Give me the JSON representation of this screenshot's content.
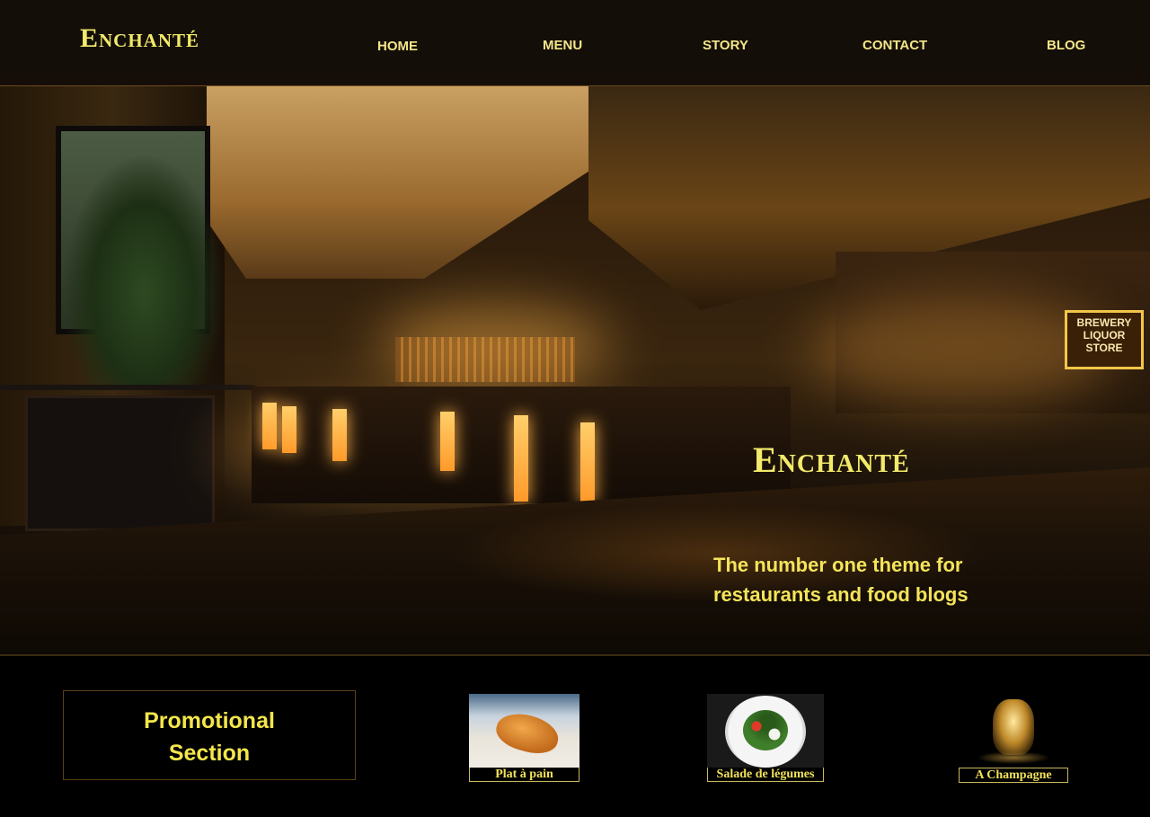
{
  "brand": {
    "logo": "Enchanté"
  },
  "nav": {
    "items": [
      {
        "label": "HOME"
      },
      {
        "label": "MENU"
      },
      {
        "label": "STORY"
      },
      {
        "label": "CONTACT"
      },
      {
        "label": "BLOG"
      }
    ]
  },
  "hero": {
    "title": "Enchanté",
    "subtitle_line1": "The number one theme for",
    "subtitle_line2": "restaurants and food blogs",
    "photo_sign": "BREWERY LIQUOR STORE"
  },
  "promo": {
    "line1": "Promotional",
    "line2": "Section"
  },
  "cards": [
    {
      "caption": "Plat à pain",
      "image": "croissant-photo"
    },
    {
      "caption": "Salade de légumes",
      "image": "salad-photo"
    },
    {
      "caption": "A Champagne",
      "image": "champagne-photo"
    }
  ],
  "colors": {
    "accent": "#f2ea6a",
    "header_bg": "#100c08",
    "page_bg": "#000000"
  }
}
